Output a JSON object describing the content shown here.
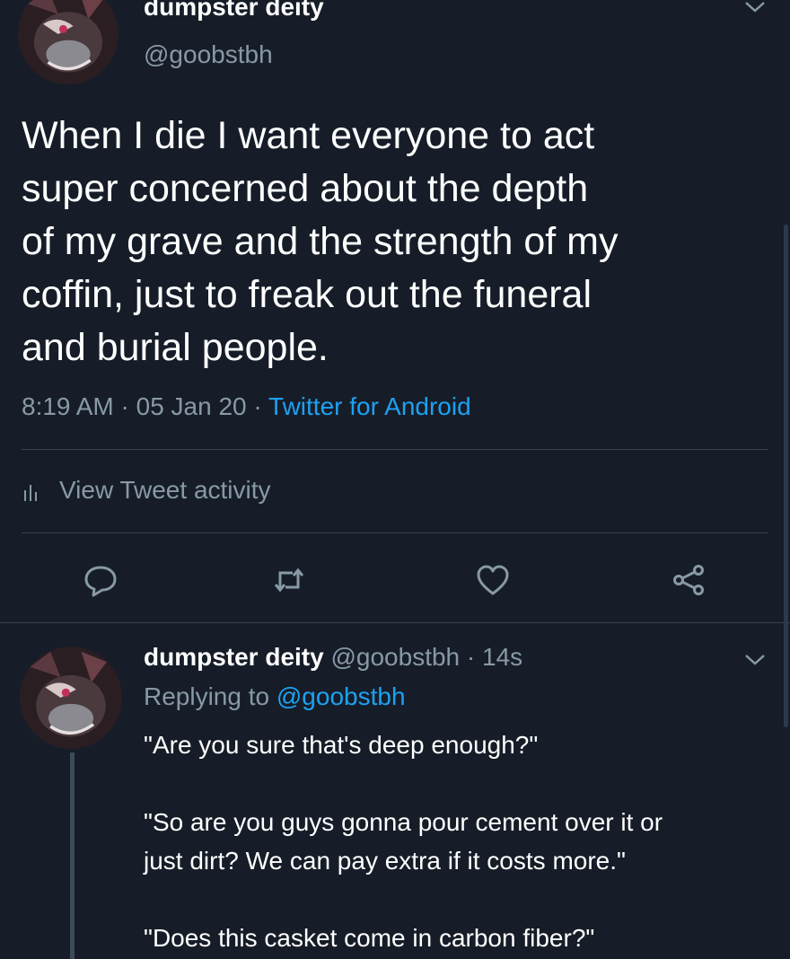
{
  "tweet": {
    "author_name": "dumpster deity",
    "author_handle": "@goobstbh",
    "text_lines": [
      "When I die I want everyone to act",
      "super concerned about the depth",
      "of my grave and the strength of my",
      "coffin, just to freak out the funeral",
      "and burial people."
    ],
    "time": "8:19 AM",
    "date": "05 Jan 20",
    "source": "Twitter for Android",
    "separator": " · "
  },
  "activity": {
    "label": "View Tweet activity",
    "icon": "bar-chart-icon"
  },
  "actions": {
    "reply_icon": "reply-icon",
    "retweet_icon": "retweet-icon",
    "like_icon": "heart-icon",
    "share_icon": "share-icon"
  },
  "reply": {
    "author_name": "dumpster deity",
    "author_handle": "@goobstbh",
    "age": "14s",
    "replying_label": "Replying to",
    "replying_to": "@goobstbh",
    "paragraphs": [
      [
        "\"Are you sure that's deep enough?\""
      ],
      [
        "\"So are you guys gonna pour cement over it or",
        "just dirt? We can pay extra if it costs more.\""
      ],
      [
        "\"Does this casket come in carbon fiber?\""
      ]
    ]
  },
  "colors": {
    "background": "#161d28",
    "text": "#ffffff",
    "secondary": "#8899a6",
    "link": "#1da1f2",
    "divider": "#38444d"
  }
}
